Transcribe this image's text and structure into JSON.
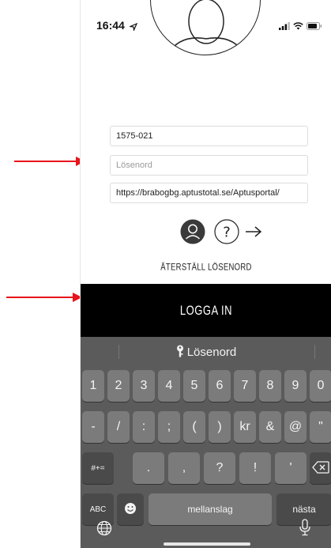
{
  "status": {
    "time": "16:44"
  },
  "form": {
    "username": "1575-021",
    "password_placeholder": "Lösenord",
    "server_url": "https://brabogbg.aptustotal.se/Aptusportal/"
  },
  "links": {
    "reset_password": "ÅTERSTÄLL LÖSENORD"
  },
  "buttons": {
    "login": "LOGGA IN"
  },
  "icons": {
    "profile": "profile-icon",
    "help": "help-icon",
    "next": "arrow-right-icon"
  },
  "keyboard": {
    "suggestion": "Lösenord",
    "row1": [
      "1",
      "2",
      "3",
      "4",
      "5",
      "6",
      "7",
      "8",
      "9",
      "0"
    ],
    "row2": [
      "-",
      "/",
      ":",
      ";",
      "(",
      ")",
      "kr",
      "&",
      "@",
      "\""
    ],
    "row3": [
      ".",
      ",",
      "?",
      "!",
      "'"
    ],
    "mode_key": "#+=",
    "abc_key": "ABC",
    "space": "mellanslag",
    "next": "nästa"
  },
  "colors": {
    "annotation": "#e8141a",
    "login_bg": "#000000",
    "keyboard_bg": "#5b5b5b"
  }
}
